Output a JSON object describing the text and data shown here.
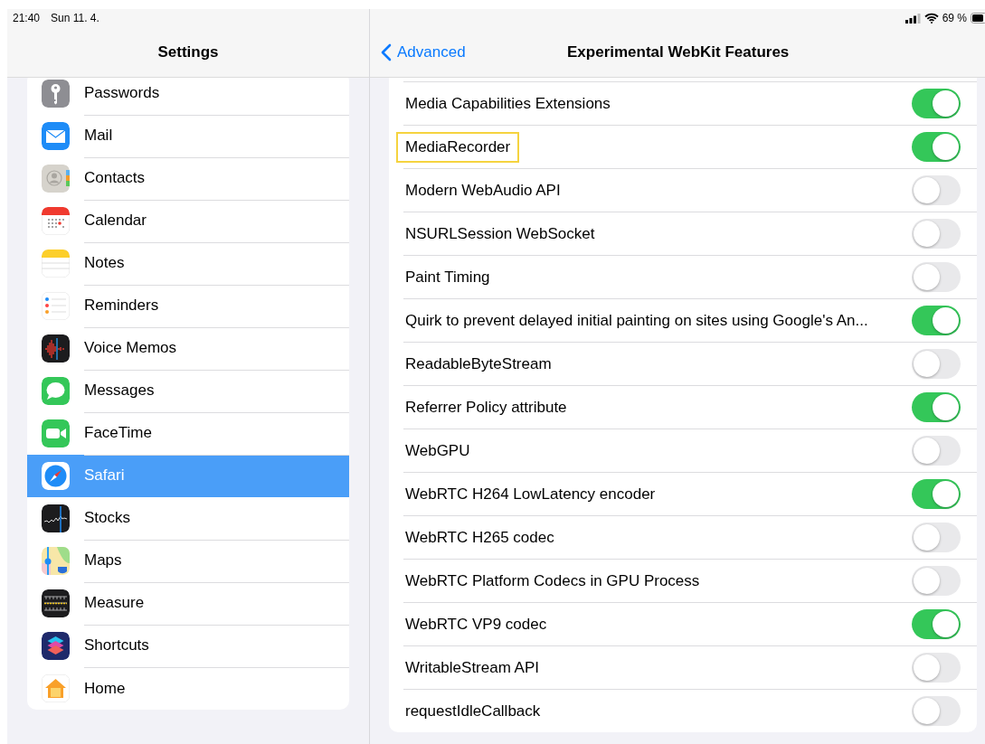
{
  "status_bar": {
    "time": "21:40",
    "date": "Sun 11. 4.",
    "battery": "69 %"
  },
  "sidebar": {
    "title": "Settings",
    "items": [
      {
        "label": "Passwords",
        "selected": false
      },
      {
        "label": "Mail",
        "selected": false
      },
      {
        "label": "Contacts",
        "selected": false
      },
      {
        "label": "Calendar",
        "selected": false
      },
      {
        "label": "Notes",
        "selected": false
      },
      {
        "label": "Reminders",
        "selected": false
      },
      {
        "label": "Voice Memos",
        "selected": false
      },
      {
        "label": "Messages",
        "selected": false
      },
      {
        "label": "FaceTime",
        "selected": false
      },
      {
        "label": "Safari",
        "selected": true
      },
      {
        "label": "Stocks",
        "selected": false
      },
      {
        "label": "Maps",
        "selected": false
      },
      {
        "label": "Measure",
        "selected": false
      },
      {
        "label": "Shortcuts",
        "selected": false
      },
      {
        "label": "Home",
        "selected": false
      }
    ]
  },
  "detail": {
    "back": "Advanced",
    "title": "Experimental WebKit Features",
    "features": [
      {
        "label": "Media Capabilities Extensions",
        "on": true,
        "highlighted": false
      },
      {
        "label": "MediaRecorder",
        "on": true,
        "highlighted": true
      },
      {
        "label": "Modern WebAudio API",
        "on": false,
        "highlighted": false
      },
      {
        "label": "NSURLSession WebSocket",
        "on": false,
        "highlighted": false
      },
      {
        "label": "Paint Timing",
        "on": false,
        "highlighted": false
      },
      {
        "label": "Quirk to prevent delayed initial painting on sites using Google's An...",
        "on": true,
        "highlighted": false
      },
      {
        "label": "ReadableByteStream",
        "on": false,
        "highlighted": false
      },
      {
        "label": "Referrer Policy attribute",
        "on": true,
        "highlighted": false
      },
      {
        "label": "WebGPU",
        "on": false,
        "highlighted": false
      },
      {
        "label": "WebRTC H264 LowLatency encoder",
        "on": true,
        "highlighted": false
      },
      {
        "label": "WebRTC H265 codec",
        "on": false,
        "highlighted": false
      },
      {
        "label": "WebRTC Platform Codecs in GPU Process",
        "on": false,
        "highlighted": false
      },
      {
        "label": "WebRTC VP9 codec",
        "on": true,
        "highlighted": false
      },
      {
        "label": "WritableStream API",
        "on": false,
        "highlighted": false
      },
      {
        "label": "requestIdleCallback",
        "on": false,
        "highlighted": false
      }
    ]
  }
}
